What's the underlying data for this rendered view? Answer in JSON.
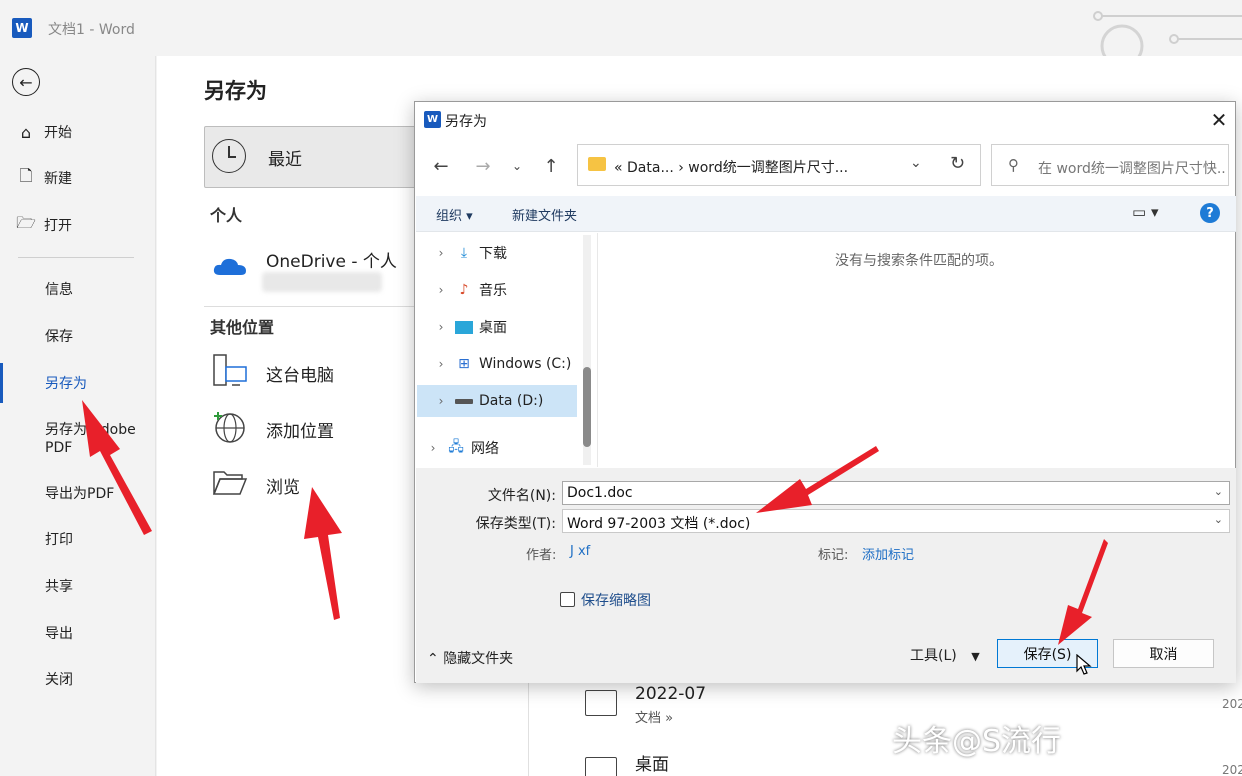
{
  "window": {
    "title": "文档1  -  Word",
    "app_icon": "W"
  },
  "nav": {
    "back": "←",
    "items": [
      {
        "label": "开始",
        "icon": "home-icon"
      },
      {
        "label": "新建",
        "icon": "new-doc-icon"
      },
      {
        "label": "打开",
        "icon": "open-folder-icon"
      }
    ],
    "plain_items": [
      "信息",
      "保存",
      "另存为",
      "另存为 Adobe PDF",
      "导出为PDF",
      "打印",
      "共享",
      "导出",
      "关闭"
    ]
  },
  "main": {
    "title": "另存为",
    "recent": "最近",
    "personal_header": "个人",
    "onedrive": "OneDrive - 个人",
    "other_header": "其他位置",
    "this_pc": "这台电脑",
    "add_location": "添加位置",
    "browse": "浏览",
    "folders": [
      {
        "name": "2022-07",
        "path": "文档 »"
      },
      {
        "name": "桌面",
        "path": ""
      }
    ],
    "date_clip": "202"
  },
  "dialog": {
    "title": "另存为",
    "close": "✕",
    "address": "«  Data...  ›  word统一调整图片尺寸...",
    "search_placeholder": "在 word统一调整图片尺寸快...",
    "organize": "组织 ▾",
    "new_folder": "新建文件夹",
    "help": "?",
    "tree": [
      {
        "label": "下载",
        "icon": "download-icon"
      },
      {
        "label": "音乐",
        "icon": "music-icon"
      },
      {
        "label": "桌面",
        "icon": "desktop-icon"
      },
      {
        "label": "Windows (C:)",
        "icon": "windows-drive-icon"
      },
      {
        "label": "Data (D:)",
        "icon": "drive-icon"
      },
      {
        "label": "网络",
        "icon": "network-icon"
      }
    ],
    "empty_message": "没有与搜索条件匹配的项。",
    "filename_label": "文件名(N):",
    "filename_value": "Doc1.doc",
    "filetype_label": "保存类型(T):",
    "filetype_value": "Word 97-2003 文档 (*.doc)",
    "author_label": "作者:",
    "author_value": "J xf",
    "tags_label": "标记:",
    "tags_value": "添加标记",
    "thumbnail_label": "保存缩略图",
    "hide_folders": "隐藏文件夹",
    "tools": "工具(L)",
    "save": "保存(S)",
    "cancel": "取消"
  },
  "watermark": "头条@S流行",
  "colors": {
    "accent": "#185abd",
    "arrow": "#e8202a"
  }
}
